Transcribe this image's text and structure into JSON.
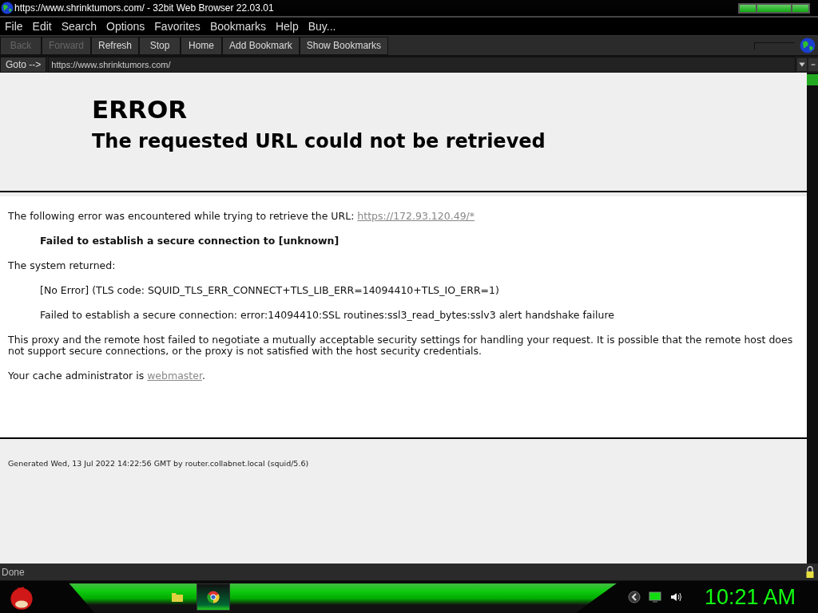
{
  "window": {
    "title": "https://www.shrinktumors.com/ - 32bit Web Browser 22.03.01"
  },
  "menu": [
    "File",
    "Edit",
    "Search",
    "Options",
    "Favorites",
    "Bookmarks",
    "Help",
    "Buy..."
  ],
  "toolbar": [
    {
      "label": "Back",
      "disabled": true
    },
    {
      "label": "Forward",
      "disabled": true
    },
    {
      "label": "Refresh",
      "disabled": false
    },
    {
      "label": "Stop",
      "disabled": false
    },
    {
      "label": "Home",
      "disabled": false
    },
    {
      "label": "Add Bookmark",
      "disabled": false
    },
    {
      "label": "Show Bookmarks",
      "disabled": false
    }
  ],
  "address": {
    "button": "Goto -->",
    "value": "https://www.shrinktumors.com/"
  },
  "page": {
    "title": "ERROR",
    "subtitle": "The requested URL could not be retrieved",
    "body": [
      {
        "kind": "text",
        "text": "The following error was encountered while trying to retrieve the URL: ",
        "link": "https://172.93.120.49/*"
      },
      {
        "kind": "indent-bold",
        "text": "Failed to establish a secure connection to [unknown]"
      },
      {
        "kind": "text",
        "text": "The system returned:"
      },
      {
        "kind": "indent",
        "text": "[No Error] (TLS code: SQUID_TLS_ERR_CONNECT+TLS_LIB_ERR=14094410+TLS_IO_ERR=1)"
      },
      {
        "kind": "indent",
        "text": "Failed to establish a secure connection: error:14094410:SSL routines:ssl3_read_bytes:sslv3 alert handshake failure"
      },
      {
        "kind": "text",
        "text": "This proxy and the remote host failed to negotiate a mutually acceptable security settings for handling your request. It is possible that the remote host does not support secure connections, or the proxy is not satisfied with the host security credentials."
      },
      {
        "kind": "text",
        "text": "Your cache administrator is ",
        "link": "webmaster",
        "after": "."
      }
    ],
    "footer": "Generated Wed, 13 Jul 2022 14:22:56 GMT by router.collabnet.local (squid/5.6)"
  },
  "status_bar": "Done",
  "taskbar": {
    "clock": "10:21 AM"
  }
}
